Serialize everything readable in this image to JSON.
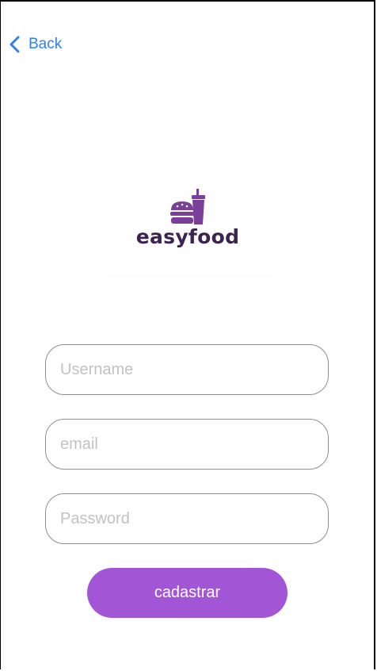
{
  "nav": {
    "back_label": "Back"
  },
  "logo": {
    "text": "easyfood",
    "icon": "burger-and-drink-icon"
  },
  "form": {
    "username": {
      "placeholder": "Username",
      "value": ""
    },
    "email": {
      "placeholder": "email",
      "value": ""
    },
    "password": {
      "placeholder": "Password",
      "value": ""
    },
    "submit_label": "cadastrar"
  },
  "colors": {
    "accent": "#a256d6",
    "link": "#2f7ff0",
    "logo_text": "#3d2350",
    "logo_icon": "#7a3f98",
    "field_border": "#8e8e8e",
    "placeholder": "#c2c2c6"
  }
}
